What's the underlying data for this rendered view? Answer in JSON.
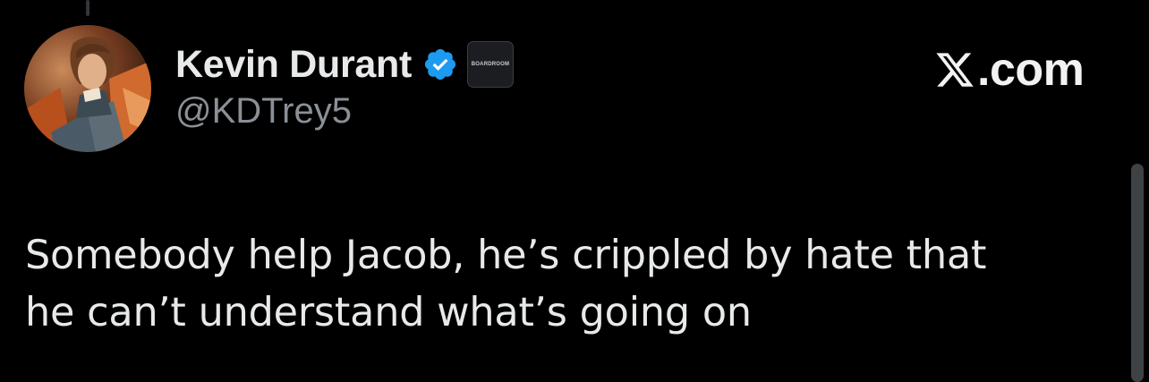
{
  "author": {
    "display_name": "Kevin Durant",
    "handle": "@KDTrey5",
    "avatar_icon": "avatar-cartoon-character",
    "verified": true,
    "verified_color": "#1d9bf0",
    "affiliate_badge_label": "BOARDROOM"
  },
  "brand": {
    "logo_icon": "x-logo-icon",
    "suffix": ".com"
  },
  "tweet": {
    "lines": [
      "Somebody help Jacob, he’s crippled by hate that",
      "he can’t understand what’s going on"
    ]
  },
  "colors": {
    "background": "#000000",
    "text_primary": "#e7e9ea",
    "text_secondary": "#8b9096"
  }
}
